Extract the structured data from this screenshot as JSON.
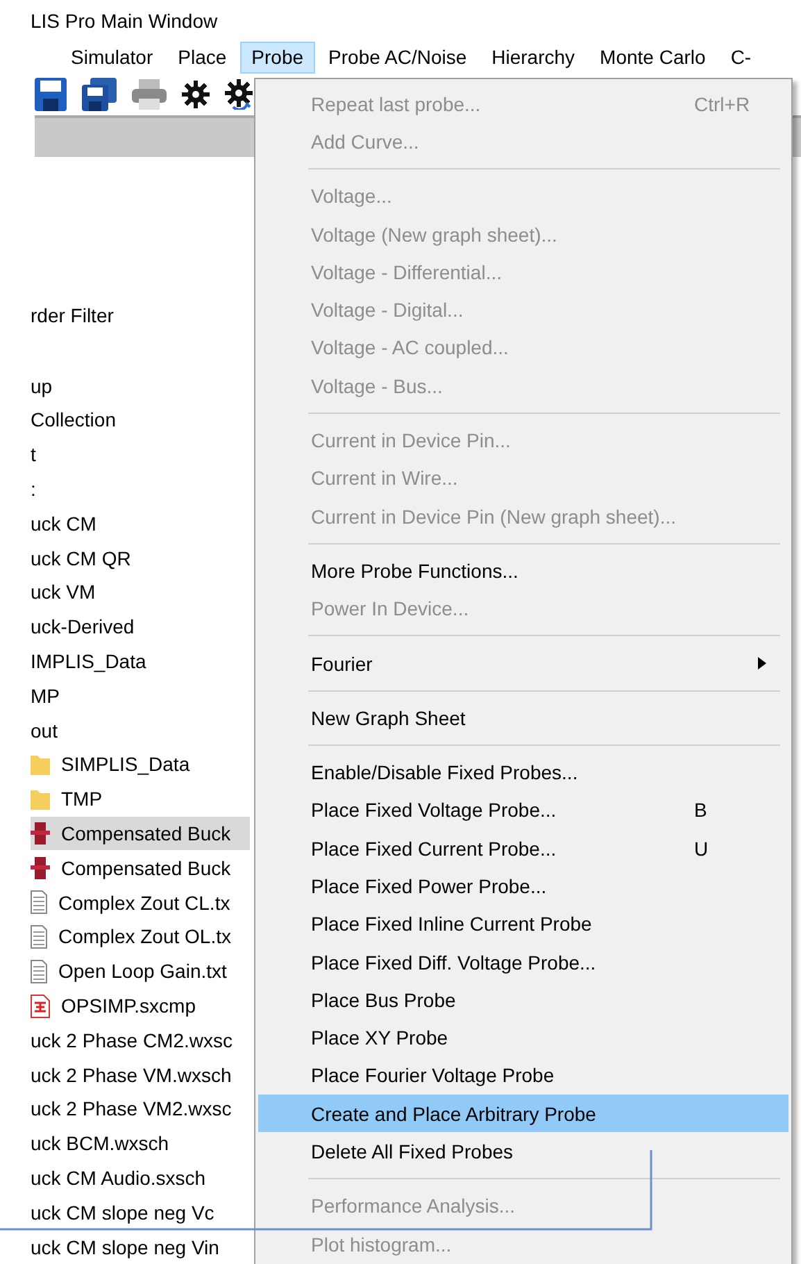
{
  "window": {
    "title": "LIS Pro Main Window"
  },
  "menubar": [
    {
      "label": "Simulator",
      "selected": false
    },
    {
      "label": "Place",
      "selected": false
    },
    {
      "label": "Probe",
      "selected": true
    },
    {
      "label": "Probe AC/Noise",
      "selected": false
    },
    {
      "label": "Hierarchy",
      "selected": false
    },
    {
      "label": "Monte Carlo",
      "selected": false
    },
    {
      "label": "C-",
      "selected": false
    }
  ],
  "filter_label": "rder Filter",
  "tree": [
    {
      "label": "up",
      "kind": "plain",
      "selected": false
    },
    {
      "label": "Collection",
      "kind": "plain",
      "selected": false
    },
    {
      "label": "t",
      "kind": "plain",
      "selected": false
    },
    {
      "label": ":",
      "kind": "plain",
      "selected": false
    },
    {
      "label": "uck CM",
      "kind": "plain",
      "selected": false
    },
    {
      "label": "uck CM QR",
      "kind": "plain",
      "selected": false
    },
    {
      "label": "uck VM",
      "kind": "plain",
      "selected": false
    },
    {
      "label": "uck-Derived",
      "kind": "plain",
      "selected": false
    },
    {
      "label": "IMPLIS_Data",
      "kind": "plain",
      "selected": false
    },
    {
      "label": "MP",
      "kind": "plain",
      "selected": false
    },
    {
      "label": "out",
      "kind": "plain",
      "selected": false
    },
    {
      "label": "SIMPLIS_Data",
      "kind": "folder",
      "selected": false
    },
    {
      "label": "TMP",
      "kind": "folder",
      "selected": false
    },
    {
      "label": "Compensated Buck",
      "kind": "schematic",
      "selected": true
    },
    {
      "label": "Compensated Buck",
      "kind": "schematic",
      "selected": false
    },
    {
      "label": "Complex Zout CL.tx",
      "kind": "text",
      "selected": false
    },
    {
      "label": "Complex Zout OL.tx",
      "kind": "text",
      "selected": false
    },
    {
      "label": "Open Loop Gain.txt",
      "kind": "text",
      "selected": false
    },
    {
      "label": "OPSIMP.sxcmp",
      "kind": "component",
      "selected": false
    },
    {
      "label": "uck 2 Phase CM2.wxsc",
      "kind": "plain",
      "selected": false
    },
    {
      "label": "uck 2 Phase VM.wxsch",
      "kind": "plain",
      "selected": false
    },
    {
      "label": "uck 2 Phase VM2.wxsc",
      "kind": "plain",
      "selected": false
    },
    {
      "label": "uck BCM.wxsch",
      "kind": "plain",
      "selected": false
    },
    {
      "label": "uck CM Audio.sxsch",
      "kind": "plain",
      "selected": false
    },
    {
      "label": "uck CM slope neg Vc",
      "kind": "plain",
      "selected": false
    },
    {
      "label": "uck CM slope neg Vin",
      "kind": "plain",
      "selected": false
    }
  ],
  "menu": [
    {
      "kind": "item",
      "label": "Repeat last probe...",
      "shortcut": "Ctrl+R",
      "disabled": true,
      "selected": false
    },
    {
      "kind": "item",
      "label": "Add Curve...",
      "disabled": true,
      "selected": false
    },
    {
      "kind": "separator"
    },
    {
      "kind": "item",
      "label": "Voltage...",
      "disabled": true,
      "selected": false
    },
    {
      "kind": "item",
      "label": "Voltage (New graph sheet)...",
      "disabled": true,
      "selected": false
    },
    {
      "kind": "item",
      "label": "Voltage - Differential...",
      "disabled": true,
      "selected": false
    },
    {
      "kind": "item",
      "label": "Voltage - Digital...",
      "disabled": true,
      "selected": false
    },
    {
      "kind": "item",
      "label": "Voltage - AC coupled...",
      "disabled": true,
      "selected": false
    },
    {
      "kind": "item",
      "label": "Voltage - Bus...",
      "disabled": true,
      "selected": false
    },
    {
      "kind": "separator"
    },
    {
      "kind": "item",
      "label": "Current in Device Pin...",
      "disabled": true,
      "selected": false
    },
    {
      "kind": "item",
      "label": "Current in Wire...",
      "disabled": true,
      "selected": false
    },
    {
      "kind": "item",
      "label": "Current in Device Pin (New graph sheet)...",
      "disabled": true,
      "selected": false
    },
    {
      "kind": "separator"
    },
    {
      "kind": "item",
      "label": "More Probe Functions...",
      "disabled": false,
      "selected": false
    },
    {
      "kind": "item",
      "label": "Power In Device...",
      "disabled": true,
      "selected": false
    },
    {
      "kind": "separator"
    },
    {
      "kind": "submenu",
      "label": "Fourier",
      "disabled": false,
      "selected": false
    },
    {
      "kind": "separator"
    },
    {
      "kind": "item",
      "label": "New Graph Sheet",
      "disabled": false,
      "selected": false
    },
    {
      "kind": "separator"
    },
    {
      "kind": "item",
      "label": "Enable/Disable Fixed Probes...",
      "disabled": false,
      "selected": false
    },
    {
      "kind": "item",
      "label": "Place Fixed Voltage Probe...",
      "shortcut": "B",
      "disabled": false,
      "selected": false
    },
    {
      "kind": "item",
      "label": "Place Fixed Current Probe...",
      "shortcut": "U",
      "disabled": false,
      "selected": false
    },
    {
      "kind": "item",
      "label": "Place Fixed Power Probe...",
      "disabled": false,
      "selected": false
    },
    {
      "kind": "item",
      "label": "Place Fixed Inline Current Probe",
      "disabled": false,
      "selected": false
    },
    {
      "kind": "item",
      "label": "Place Fixed Diff. Voltage Probe...",
      "disabled": false,
      "selected": false
    },
    {
      "kind": "item",
      "label": "Place Bus Probe",
      "disabled": false,
      "selected": false
    },
    {
      "kind": "item",
      "label": "Place XY Probe",
      "disabled": false,
      "selected": false
    },
    {
      "kind": "item",
      "label": "Place Fourier Voltage Probe",
      "disabled": false,
      "selected": false
    },
    {
      "kind": "item",
      "label": "Create and Place Arbitrary Probe",
      "disabled": false,
      "selected": true
    },
    {
      "kind": "item",
      "label": "Delete All Fixed Probes",
      "disabled": false,
      "selected": false
    },
    {
      "kind": "separator"
    },
    {
      "kind": "item",
      "label": "Performance Analysis...",
      "disabled": true,
      "selected": false
    },
    {
      "kind": "item",
      "label": "Plot histogram...",
      "disabled": true,
      "selected": false
    }
  ]
}
